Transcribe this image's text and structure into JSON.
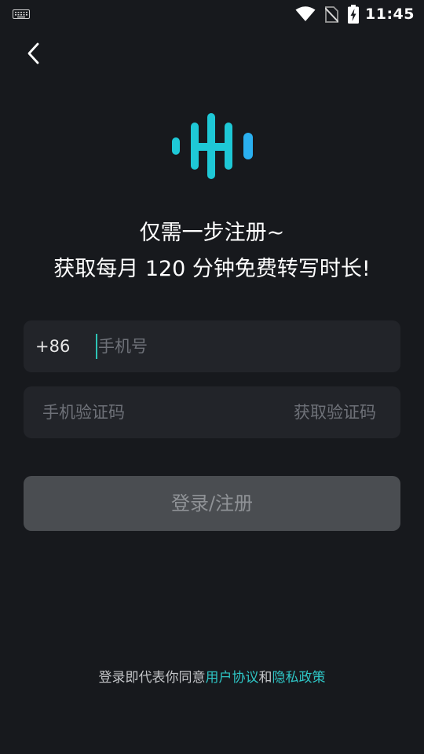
{
  "status_bar": {
    "time": "11:45",
    "icons": [
      "keyboard-icon",
      "wifi-icon",
      "no-sim-icon",
      "battery-charging-icon"
    ]
  },
  "nav": {
    "back_icon": "chevron-left-icon"
  },
  "logo": {
    "icon": "audio-waveform-logo",
    "colors": [
      "#1ec8d6",
      "#2ab0f0"
    ]
  },
  "headline": {
    "line1": "仅需一步注册~",
    "line2": "获取每月 120 分钟免费转写时长!"
  },
  "phone_field": {
    "country_code": "+86",
    "placeholder": "手机号",
    "value": ""
  },
  "code_field": {
    "placeholder": "手机验证码",
    "value": "",
    "get_code_label": "获取验证码"
  },
  "login_button": {
    "label": "登录/注册"
  },
  "agreement": {
    "prefix": "登录即代表你同意",
    "user_agreement_link": "用户协议",
    "conjunction": "和",
    "privacy_policy_link": "隐私政策"
  },
  "colors": {
    "background": "#17191d",
    "field_background": "#222429",
    "button_disabled": "#4a4d51",
    "accent": "#2ec4c4"
  }
}
